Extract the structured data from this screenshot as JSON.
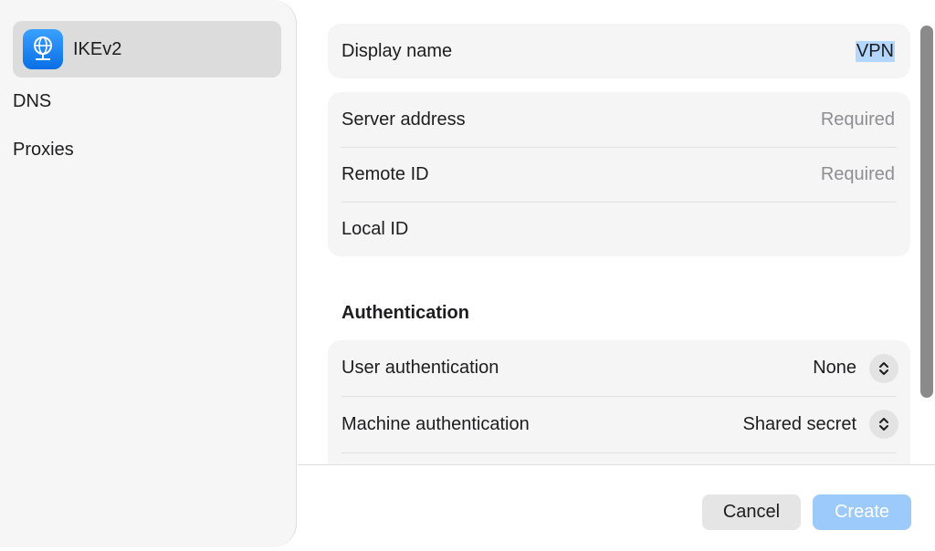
{
  "sidebar": {
    "items": [
      {
        "label": "IKEv2",
        "icon": "globe-network-icon",
        "selected": true
      },
      {
        "label": "DNS",
        "selected": false
      },
      {
        "label": "Proxies",
        "selected": false
      }
    ]
  },
  "general": {
    "display_name_label": "Display name",
    "display_name_value": "VPN"
  },
  "server": {
    "server_address_label": "Server address",
    "server_address_placeholder": "Required",
    "remote_id_label": "Remote ID",
    "remote_id_placeholder": "Required",
    "local_id_label": "Local ID",
    "local_id_value": ""
  },
  "authentication": {
    "title": "Authentication",
    "user_auth_label": "User authentication",
    "user_auth_value": "None",
    "machine_auth_label": "Machine authentication",
    "machine_auth_value": "Shared secret"
  },
  "footer": {
    "cancel_label": "Cancel",
    "create_label": "Create"
  },
  "colors": {
    "accent": "#0a84ff",
    "selection_highlight": "#b4d7ff",
    "create_disabled": "#9ccbfb"
  }
}
